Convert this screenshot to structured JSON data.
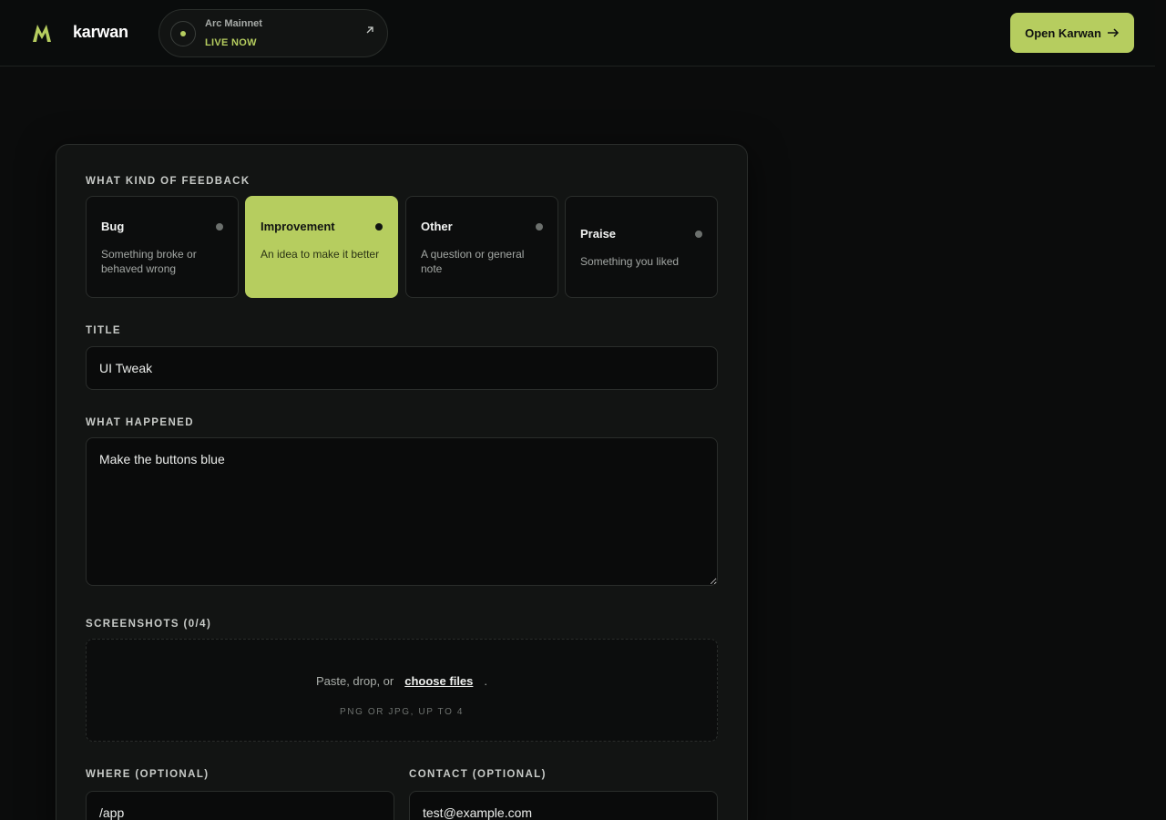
{
  "background_text": "",
  "header": {
    "brand": "karwan",
    "network": {
      "name": "Arc Mainnet",
      "status": "LIVE NOW"
    },
    "open_button": "Open Karwan",
    "accent": "#b6cd5f"
  },
  "form": {
    "kind_label": "WHAT KIND OF FEEDBACK",
    "types": [
      {
        "title": "Bug",
        "desc": "Something broke or behaved wrong",
        "selected": false
      },
      {
        "title": "Improvement",
        "desc": "An idea to make it better",
        "selected": true
      },
      {
        "title": "Other",
        "desc": "A question or general note",
        "selected": false
      },
      {
        "title": "Praise",
        "desc": "Something you liked",
        "selected": false
      }
    ],
    "title_label": "TITLE",
    "title_value": "UI Tweak",
    "happened_label": "WHAT HAPPENED",
    "happened_value": "Make the buttons blue",
    "screenshots_label": "SCREENSHOTS (0/4)",
    "drop_prefix": "Paste, drop, or",
    "drop_link": "choose files",
    "drop_suffix": ".",
    "drop_hint": "PNG OR JPG, UP TO 4",
    "where_label": "WHERE (OPTIONAL)",
    "where_value": "/app",
    "contact_label": "CONTACT (OPTIONAL)",
    "contact_value": "test@example.com"
  }
}
